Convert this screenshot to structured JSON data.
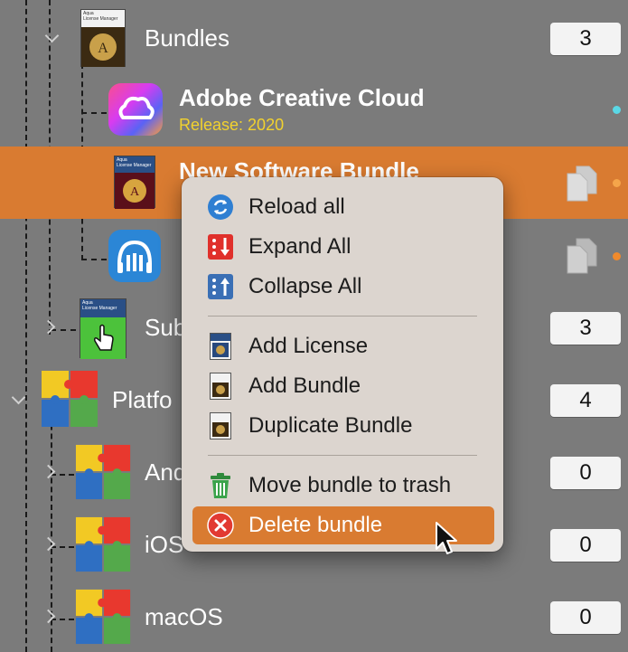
{
  "tree": {
    "bundles": {
      "label": "Bundles",
      "count": "3"
    },
    "adobe": {
      "title": "Adobe Creative Cloud",
      "subtitle": "Release: 2020"
    },
    "new_bundle": {
      "title": "New Software Bundle"
    },
    "subscriptions": {
      "label": "Sub",
      "count": "3"
    },
    "platforms": {
      "label": "Platfo",
      "count": "4"
    },
    "android": {
      "label": "And",
      "count": "0"
    },
    "ios": {
      "label": "iOS",
      "count": "0"
    },
    "macos": {
      "label": "macOS",
      "count": "0"
    }
  },
  "colors": {
    "accent": "#d97b31",
    "cyan_dot": "#5ad8e6",
    "orange_dot": "#f08a2c",
    "subtitle": "#f2d22e"
  },
  "menu": {
    "reload_all": "Reload all",
    "expand_all": "Expand All",
    "collapse_all": "Collapse All",
    "add_license": "Add License",
    "add_bundle": "Add Bundle",
    "duplicate_bundle": "Duplicate Bundle",
    "move_to_trash": "Move bundle to trash",
    "delete_bundle": "Delete bundle"
  },
  "icons": [
    "reload-icon",
    "expand-icon",
    "collapse-icon",
    "license-icon",
    "bundle-icon",
    "duplicate-icon",
    "trash-icon",
    "delete-icon",
    "mouse-cursor-icon",
    "documents-icon"
  ]
}
